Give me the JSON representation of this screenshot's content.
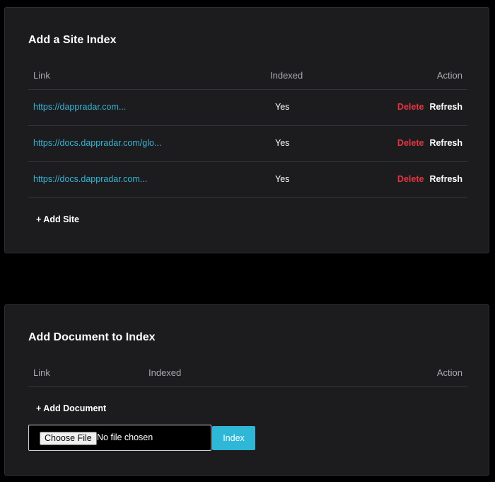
{
  "site_index": {
    "title": "Add a Site Index",
    "columns": {
      "link": "Link",
      "indexed": "Indexed",
      "action": "Action"
    },
    "rows": [
      {
        "link": "https://dappradar.com...",
        "indexed": "Yes",
        "delete": "Delete",
        "refresh": "Refresh"
      },
      {
        "link": "https://docs.dappradar.com/glo...",
        "indexed": "Yes",
        "delete": "Delete",
        "refresh": "Refresh"
      },
      {
        "link": "https://docs.dappradar.com...",
        "indexed": "Yes",
        "delete": "Delete",
        "refresh": "Refresh"
      }
    ],
    "add_label": "+ Add Site"
  },
  "doc_index": {
    "title": "Add Document to Index",
    "columns": {
      "link": "Link",
      "indexed": "Indexed",
      "action": "Action"
    },
    "add_label": "+ Add Document",
    "file_input": {
      "choose_label": "Choose File",
      "status": "No file chosen"
    },
    "index_label": "Index"
  },
  "colors": {
    "background": "#000000",
    "panel": "#1c1c1f",
    "link": "#39b3d3",
    "delete": "#e0353f",
    "primary_button": "#2fb7d8"
  }
}
